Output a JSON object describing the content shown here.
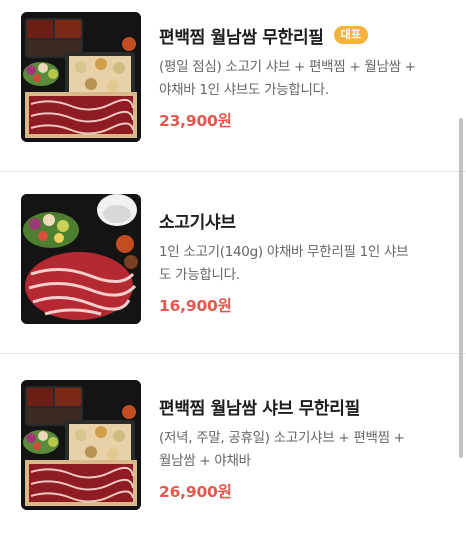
{
  "menu": {
    "items": [
      {
        "name": "편백찜 월남쌈 무한리필",
        "badge": "대표",
        "desc_lines": [
          "(평일 점심) 소고기 샤브 + 편백찜 + 월남쌈 +",
          "야채바 1인 샤브도 가능합니다."
        ],
        "price": "23,900원",
        "image": "hinoki-box-platter-photo"
      },
      {
        "name": "소고기샤브",
        "desc_lines": [
          "1인 소고기(140g) 야채바 무한리필 1인 샤브",
          "도 가능합니다."
        ],
        "price": "16,900원",
        "image": "beef-shabu-platter-photo"
      },
      {
        "name": "편백찜 월남쌈 샤브 무한리필",
        "desc_lines": [
          "(저녁, 주말, 공휴일) 소고기샤브 + 편백찜 +",
          "월남쌈 + 야채바"
        ],
        "price": "26,900원",
        "image": "hinoki-box-platter-photo"
      }
    ]
  },
  "colors": {
    "price": "#e2584e",
    "badge": "#f3b23c",
    "divider": "#e6e6e6"
  }
}
